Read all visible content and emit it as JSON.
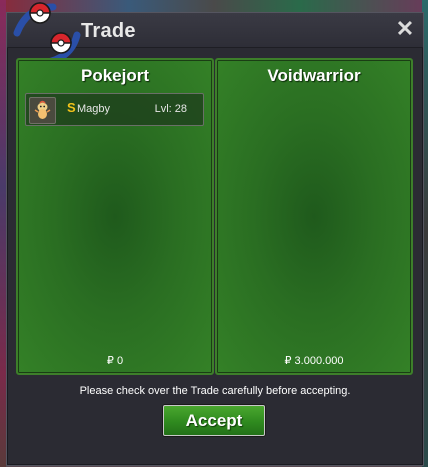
{
  "window": {
    "title": "Trade",
    "close_symbol": "✕"
  },
  "left_panel": {
    "player_name": "Pokejort",
    "items": [
      {
        "icon": "magby-sprite-icon",
        "shiny_marker": "S",
        "name": "Magby",
        "level": "Lvl: 28"
      }
    ],
    "money": "₽ 0"
  },
  "right_panel": {
    "player_name": "Voidwarrior",
    "money": "₽ 3.000.000"
  },
  "footer": {
    "notice": "Please check over the Trade carefully before accepting.",
    "accept_label": "Accept"
  },
  "colors": {
    "panel_green": "#2a6e22",
    "accept_green": "#2f8a1f",
    "window_bg": "#2b2b33",
    "shiny_gold": "#f2c21a"
  }
}
